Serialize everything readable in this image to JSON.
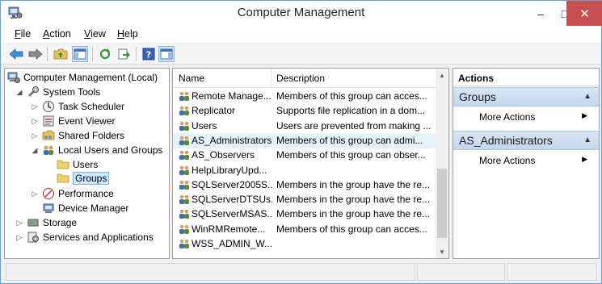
{
  "window": {
    "title": "Computer Management",
    "minimize": "–",
    "maximize": "□",
    "close": "✕"
  },
  "menu": [
    {
      "acc": "F",
      "rest": "ile"
    },
    {
      "acc": "A",
      "rest": "ction"
    },
    {
      "acc": "V",
      "rest": "iew"
    },
    {
      "acc": "H",
      "rest": "elp"
    }
  ],
  "toolbar": {
    "buttons": [
      "back-icon",
      "forward-icon",
      "up-folder-icon",
      "show-hide-tree-icon",
      "refresh-icon",
      "export-list-icon",
      "help-icon",
      "show-hide-action-pane-icon"
    ]
  },
  "tree": {
    "items": [
      {
        "label": "Computer Management (Local)",
        "icon": "computer-management-icon"
      },
      {
        "label": "System Tools",
        "icon": "system-tools-icon"
      },
      {
        "label": "Task Scheduler",
        "icon": "task-scheduler-icon"
      },
      {
        "label": "Event Viewer",
        "icon": "event-viewer-icon"
      },
      {
        "label": "Shared Folders",
        "icon": "shared-folders-icon"
      },
      {
        "label": "Local Users and Groups",
        "icon": "local-users-groups-icon"
      },
      {
        "label": "Users",
        "icon": "folder-icon"
      },
      {
        "label": "Groups",
        "icon": "folder-icon"
      },
      {
        "label": "Performance",
        "icon": "performance-icon"
      },
      {
        "label": "Device Manager",
        "icon": "device-manager-icon"
      },
      {
        "label": "Storage",
        "icon": "storage-icon"
      },
      {
        "label": "Services and Applications",
        "icon": "services-applications-icon"
      }
    ]
  },
  "list": {
    "columns": {
      "name": "Name",
      "description": "Description"
    },
    "rows": [
      {
        "name": "Remote Manage...",
        "description": "Members of this group can acces..."
      },
      {
        "name": "Replicator",
        "description": "Supports file replication in a dom..."
      },
      {
        "name": "Users",
        "description": "Users are prevented from making ..."
      },
      {
        "name": "AS_Administrators",
        "description": "Members of this group can admi..."
      },
      {
        "name": "AS_Observers",
        "description": "Members of this group can obser..."
      },
      {
        "name": "HelpLibraryUpd...",
        "description": ""
      },
      {
        "name": "SQLServer2005S...",
        "description": "Members in the group have the re..."
      },
      {
        "name": "SQLServerDTSUs...",
        "description": "Members in the group have the re..."
      },
      {
        "name": "SQLServerMSAS...",
        "description": "Members in the group have the re..."
      },
      {
        "name": "WinRMRemote...",
        "description": "Members of this group can acces..."
      },
      {
        "name": "WSS_ADMIN_W...",
        "description": ""
      }
    ]
  },
  "actions": {
    "header": "Actions",
    "groups": [
      {
        "title": "Groups",
        "item": "More Actions"
      },
      {
        "title": "AS_Administrators",
        "item": "More Actions"
      }
    ]
  },
  "colors": {
    "accent": "#cce8ff",
    "close_button": "#c74f4f",
    "action_group": "#c8daee"
  }
}
